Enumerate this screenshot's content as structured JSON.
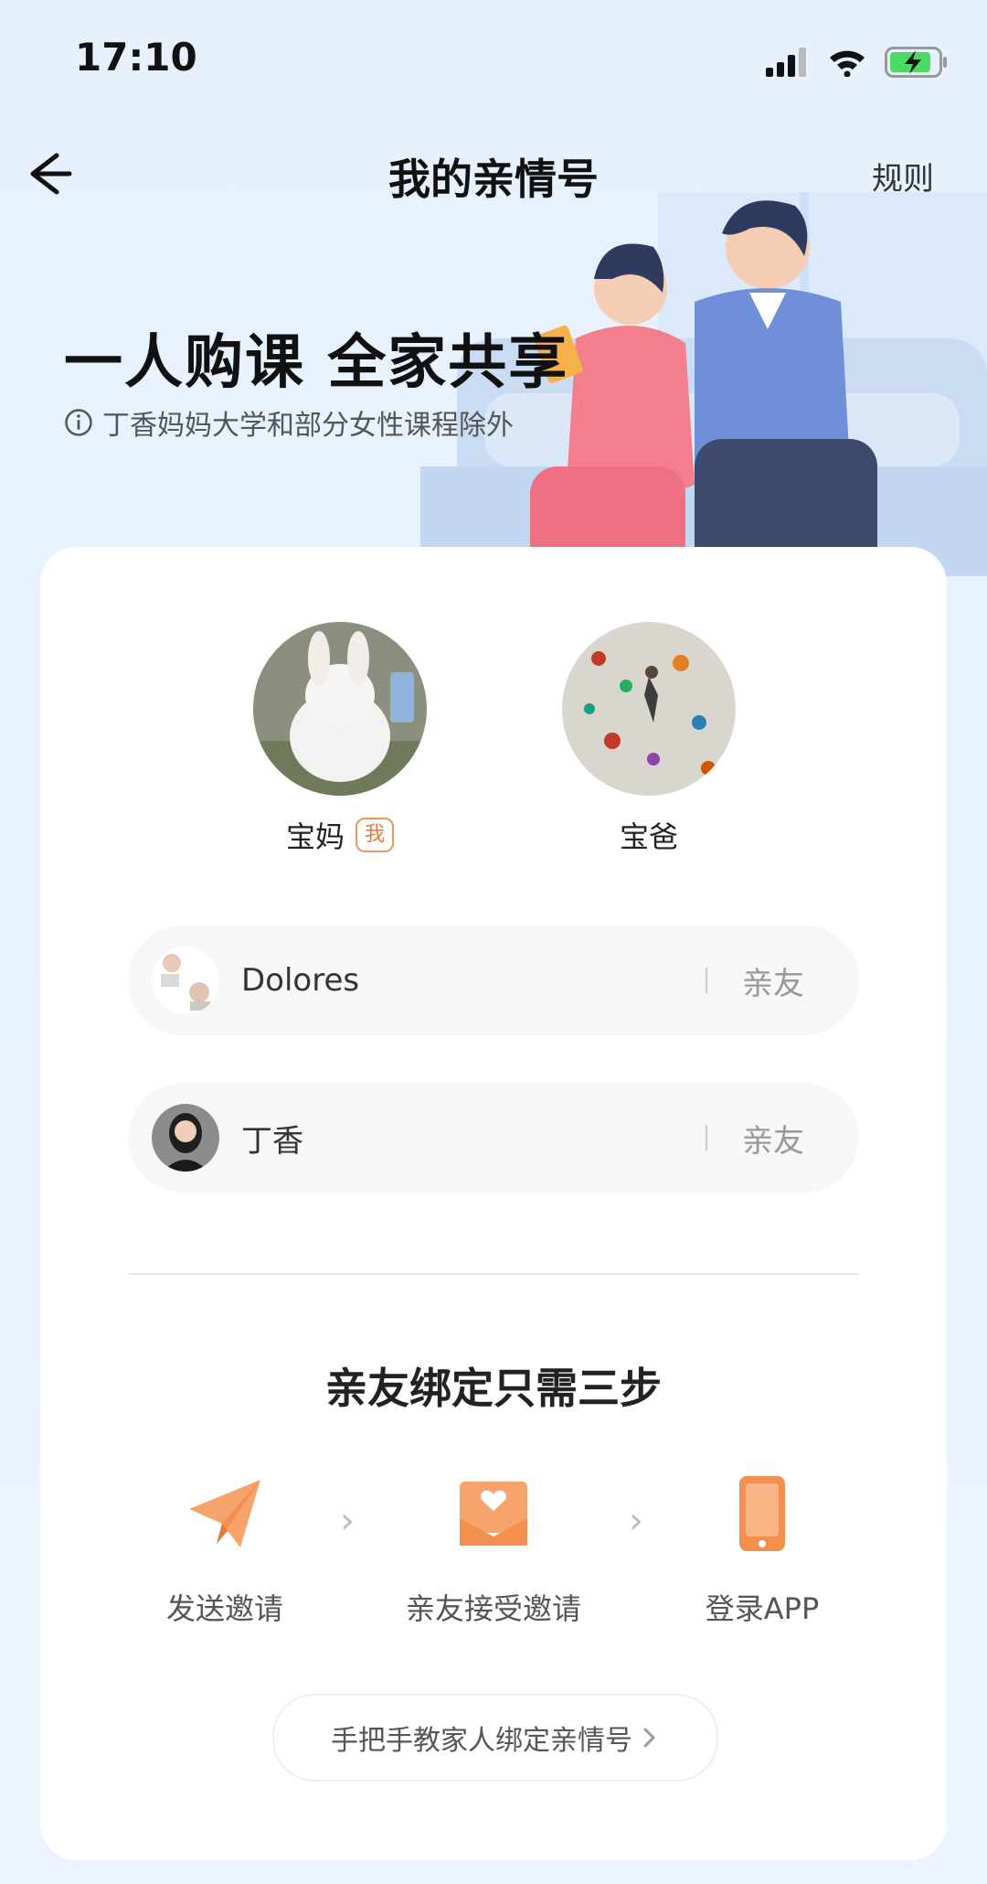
{
  "status_bar": {
    "time": "17:10"
  },
  "nav": {
    "title": "我的亲情号",
    "rule_label": "规则"
  },
  "hero": {
    "title": "一人购课 全家共享",
    "subtitle": "丁香妈妈大学和部分女性课程除外"
  },
  "members": [
    {
      "name": "宝妈",
      "badge": "我"
    },
    {
      "name": "宝爸"
    }
  ],
  "friends": [
    {
      "name": "Dolores",
      "relation": "亲友"
    },
    {
      "name": "丁香",
      "relation": "亲友"
    }
  ],
  "steps": {
    "title": "亲友绑定只需三步",
    "items": [
      {
        "label": "发送邀请",
        "icon": "paper-plane-icon"
      },
      {
        "label": "亲友接受邀请",
        "icon": "envelope-heart-icon"
      },
      {
        "label": "登录APP",
        "icon": "phone-icon"
      }
    ]
  },
  "tutorial_button": {
    "label": "手把手教家人绑定亲情号"
  },
  "colors": {
    "accent": "#f59a5c",
    "card": "#ffffff",
    "background": "#e8f2fe"
  }
}
